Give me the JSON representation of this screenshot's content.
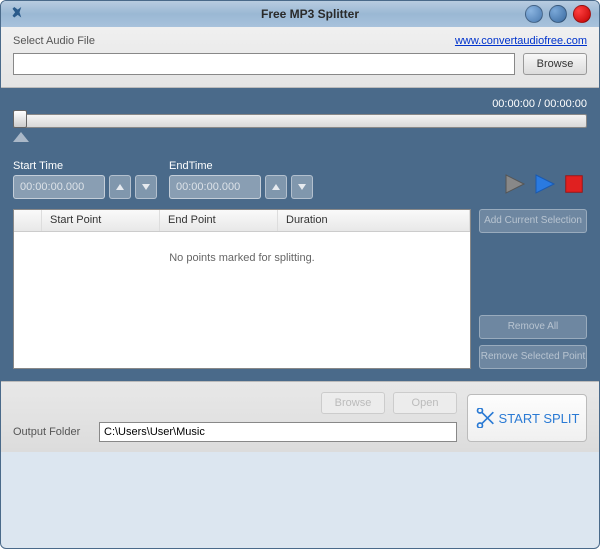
{
  "titlebar": {
    "title": "Free MP3 Splitter"
  },
  "top": {
    "select_label": "Select Audio File",
    "website_url": "www.convertaudiofree.com",
    "file_value": "",
    "browse_label": "Browse"
  },
  "time_display": "00:00:00 / 00:00:00",
  "start_time": {
    "label": "Start Time",
    "value": "00:00:00.000"
  },
  "end_time": {
    "label": "EndTime",
    "value": "00:00:00.000"
  },
  "table": {
    "col_start": "Start Point",
    "col_end": "End Point",
    "col_duration": "Duration",
    "empty_message": "No points marked for splitting."
  },
  "side_buttons": {
    "add": "Add Current Selection",
    "remove_all": "Remove All",
    "remove_selected": "Remove Selected Point"
  },
  "bottom": {
    "browse_label": "Browse",
    "open_label": "Open",
    "output_label": "Output Folder",
    "output_value": "C:\\Users\\User\\Music",
    "start_split_label": "START SPLIT"
  }
}
